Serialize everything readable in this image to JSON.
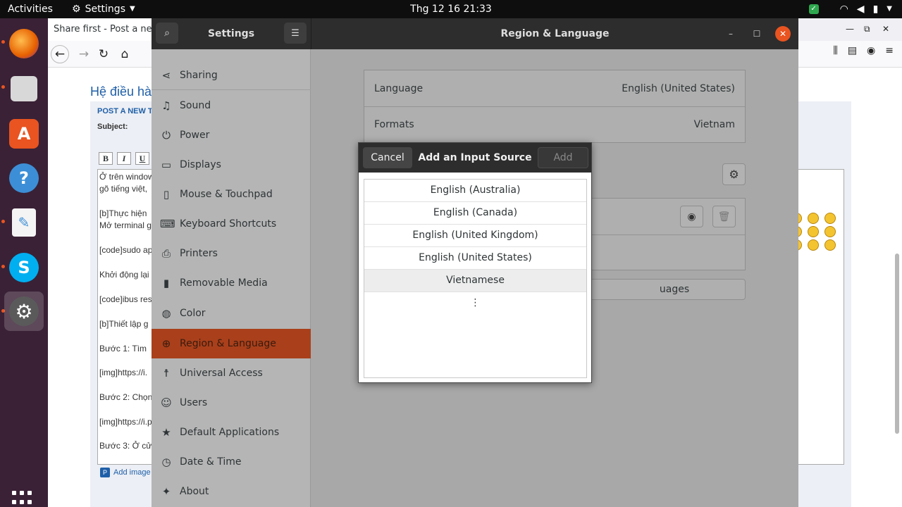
{
  "topbar": {
    "activities": "Activities",
    "app_menu": "Settings",
    "clock": "Thg 12 16  21:33"
  },
  "dock": {
    "items": [
      {
        "name": "firefox",
        "color": "#e66000"
      },
      {
        "name": "files",
        "color": "#cccccc"
      },
      {
        "name": "software",
        "color": "#e95420"
      },
      {
        "name": "help",
        "color": "#3c8fd6"
      },
      {
        "name": "text-editor",
        "color": "#3c8fd6"
      },
      {
        "name": "skype",
        "color": "#00aff0"
      },
      {
        "name": "settings",
        "color": "#666666"
      }
    ]
  },
  "firefox": {
    "tab_title": "Share first - Post a new",
    "heading": "Hệ điều hà",
    "post_label": "POST A NEW TO",
    "subject_label": "Subject:",
    "format_buttons": [
      "B",
      "I",
      "U"
    ],
    "lines": [
      "Ở trên window",
      "gõ tiếng việt,",
      "[b]Thực hiện",
      "Mở terminal g",
      "[code]sudo ap",
      "Khởi động lại",
      "[code]ibus res",
      "[b]Thiết lập g",
      "Bước 1: Tìm",
      "[img]https://i.",
      "Bước 2: Chọn",
      "[img]https://i.p",
      "Bước 3: Ở cử"
    ],
    "add_image": "Add image"
  },
  "settings": {
    "sidebar_title": "Settings",
    "panel_title": "Region & Language",
    "sidebar_items": [
      {
        "label": "Sharing",
        "icon": "share-icon"
      },
      {
        "label": "Sound",
        "icon": "music-note-icon"
      },
      {
        "label": "Power",
        "icon": "power-icon"
      },
      {
        "label": "Displays",
        "icon": "display-icon"
      },
      {
        "label": "Mouse & Touchpad",
        "icon": "mouse-icon"
      },
      {
        "label": "Keyboard Shortcuts",
        "icon": "keyboard-icon"
      },
      {
        "label": "Printers",
        "icon": "printer-icon"
      },
      {
        "label": "Removable Media",
        "icon": "usb-icon"
      },
      {
        "label": "Color",
        "icon": "color-icon"
      },
      {
        "label": "Region & Language",
        "icon": "globe-icon"
      },
      {
        "label": "Universal Access",
        "icon": "accessibility-icon"
      },
      {
        "label": "Users",
        "icon": "users-icon"
      },
      {
        "label": "Default Applications",
        "icon": "star-icon"
      },
      {
        "label": "Date & Time",
        "icon": "clock-icon"
      },
      {
        "label": "About",
        "icon": "about-icon"
      }
    ],
    "selected_item": "Region & Language",
    "language_label": "Language",
    "language_value": "English (United States)",
    "formats_label": "Formats",
    "formats_value": "Vietnam",
    "manage_languages_fragment": "uages"
  },
  "dialog": {
    "cancel": "Cancel",
    "title": "Add an Input Source",
    "add": "Add",
    "items": [
      "English (Australia)",
      "English (Canada)",
      "English (United Kingdom)",
      "English (United States)",
      "Vietnamese"
    ],
    "more": "⋮"
  },
  "colors": {
    "accent": "#e95420",
    "selected_sidebar": "#a9401b",
    "header_dark": "#2d2d2d",
    "dock_bg": "#3a2136"
  }
}
